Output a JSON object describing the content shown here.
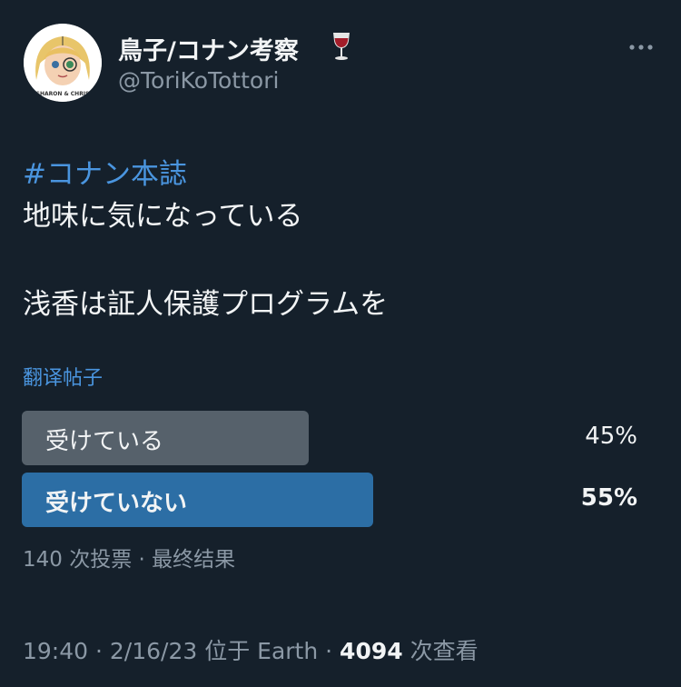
{
  "author": {
    "display_name": "鳥子/コナン考察",
    "handle": "@ToriKoTottori",
    "name_emoji_icon": "wine-glass-icon",
    "avatar_caption": "SHARON & CHRIS"
  },
  "tweet": {
    "hashtag": "#コナン本誌",
    "line1": "地味に気になっている",
    "line2": "浅香は証人保護プログラムを"
  },
  "translate_label": "翻译帖子",
  "poll": {
    "options": [
      {
        "label": "受けている",
        "percent_text": "45%",
        "percent": 45,
        "winner": false
      },
      {
        "label": "受けていない",
        "percent_text": "55%",
        "percent": 55,
        "winner": true
      }
    ],
    "summary": "140 次投票 · 最终结果",
    "colors": {
      "bar": "#56616b",
      "winner_bar": "#2c6ea5"
    }
  },
  "meta": {
    "time_location": "19:40 · 2/16/23 位于 Earth · ",
    "views_count": "4094",
    "views_label": " 次查看"
  },
  "colors": {
    "background": "#15202b",
    "accent": "#4a95df",
    "secondary_text": "#8b98a5"
  },
  "icons": {
    "more": "more-horizontal-icon"
  }
}
